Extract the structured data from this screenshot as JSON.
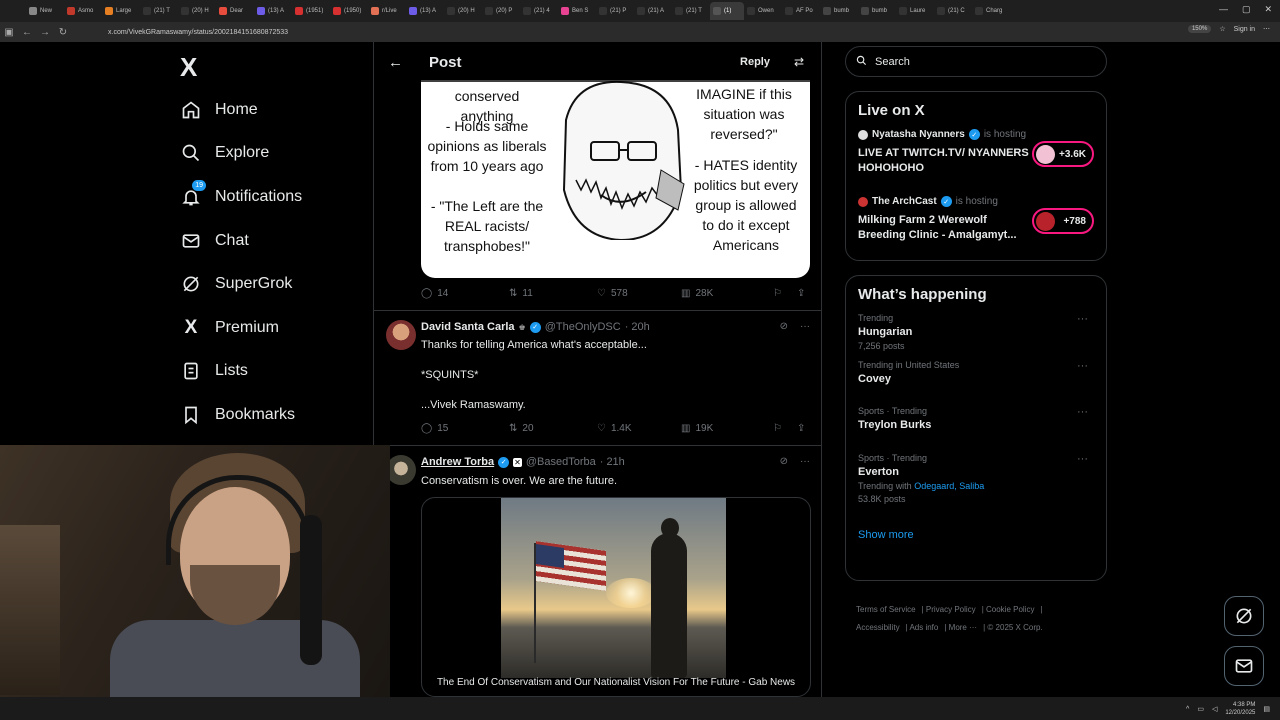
{
  "browser": {
    "tabs": [
      "New",
      "Asmo",
      "Large",
      "(21) T",
      "(20) H",
      "Dear",
      "(13) A",
      "(1951)",
      "(1950)",
      "r/Live",
      "(13) A",
      "(20) H",
      "(20) P",
      "(21) 4",
      "Ben S",
      "(21) P",
      "(21) A",
      "(21) T",
      "(1)",
      "Owen",
      "AF Po",
      "bumb",
      "bumb",
      "Laure",
      "(21) C",
      "Charg"
    ],
    "url": "x.com/VivekGRamaswamy/status/2002184151680872533",
    "zoom": "150%",
    "sign_in": "Sign in"
  },
  "sidebar": {
    "logo": "X",
    "items": [
      {
        "label": "Home",
        "icon": "home-icon"
      },
      {
        "label": "Explore",
        "icon": "search-icon"
      },
      {
        "label": "Notifications",
        "icon": "bell-icon",
        "badge": "19"
      },
      {
        "label": "Chat",
        "icon": "mail-icon"
      },
      {
        "label": "SuperGrok",
        "icon": "grok-icon"
      },
      {
        "label": "Premium",
        "icon": "x-icon"
      },
      {
        "label": "Lists",
        "icon": "list-icon"
      },
      {
        "label": "Bookmarks",
        "icon": "bookmark-icon"
      }
    ]
  },
  "header": {
    "title": "Post",
    "reply": "Reply"
  },
  "meme": {
    "t1": "conserved anything",
    "t2": "- Holds same\nopinions as liberals\nfrom 10 years ago",
    "t3": "- \"The Left are the\nREAL racists/\ntransphobes!\"",
    "t4": "IMAGINE if this\nsituation was\nreversed?\"",
    "t5": "- HATES identity\npolitics but every\ngroup is allowed\nto do it except\nAmericans"
  },
  "main_actions": {
    "replies": "14",
    "reposts": "11",
    "likes": "578",
    "views": "28K"
  },
  "replies": [
    {
      "name": "David Santa Carla",
      "handle": "@TheOnlyDSC",
      "time": "· 20h",
      "lines": [
        "Thanks for telling America what's acceptable...",
        "*SQUINTS*",
        "...Vivek Ramaswamy."
      ],
      "replies": "15",
      "reposts": "20",
      "likes": "1.4K",
      "views": "19K"
    },
    {
      "name": "Andrew Torba",
      "handle": "@BasedTorba",
      "time": "· 21h",
      "text": "Conservatism is over. We are the future.",
      "card_caption": "The End Of Conservatism and Our Nationalist Vision For The Future - Gab News"
    }
  ],
  "search": {
    "placeholder": "Search"
  },
  "live": {
    "title": "Live on X",
    "items": [
      {
        "host": "Nyatasha Nyanners",
        "hosting": "is hosting",
        "title": "LIVE AT TWITCH.TV/ NYANNERS HOHOHOHO",
        "count": "+3.6K"
      },
      {
        "host": "The ArchCast",
        "hosting": "is hosting",
        "title": "Milking Farm 2 Werewolf Breeding Clinic - Amalgamyt...",
        "count": "+788"
      }
    ]
  },
  "happening": {
    "title": "What’s happening",
    "trends": [
      {
        "context": "Trending",
        "name": "Hungarian",
        "count": "7,256 posts"
      },
      {
        "context": "Trending in United States",
        "name": "Covey",
        "count": ""
      },
      {
        "context": "Sports · Trending",
        "name": "Treylon Burks",
        "count": ""
      },
      {
        "context": "Sports · Trending",
        "name": "Everton",
        "with_label": "Trending with",
        "with_links": "Odegaard, Saliba",
        "count": "53.8K posts"
      }
    ],
    "show_more": "Show more"
  },
  "footer": [
    "Terms of Service",
    "Privacy Policy",
    "Cookie Policy",
    "Accessibility",
    "Ads info",
    "More ···",
    "© 2025 X Corp."
  ],
  "taskbar": {
    "time": "4:38 PM",
    "date": "12/20/2025"
  },
  "colors": {
    "accent": "#1d9bf0",
    "live": "#f91880",
    "bg": "#000000",
    "muted": "#71767b"
  }
}
